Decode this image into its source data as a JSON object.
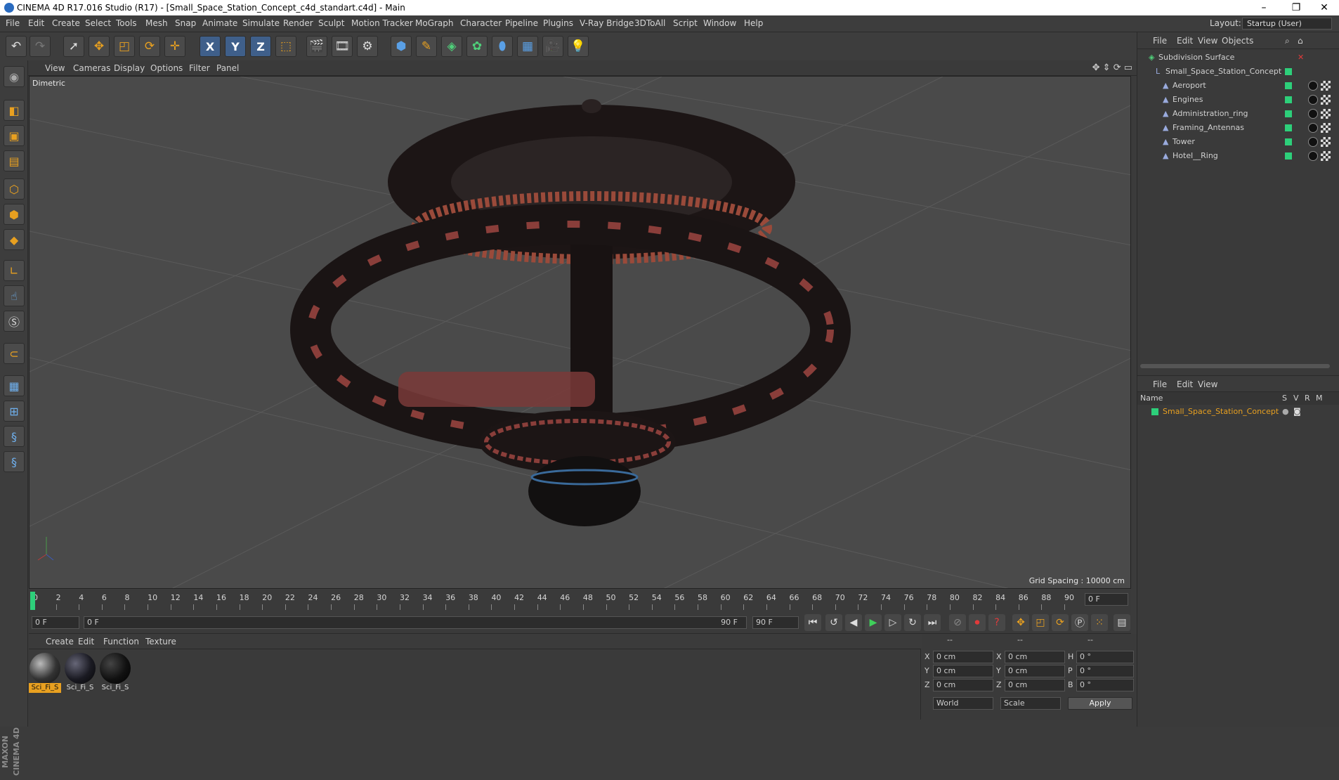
{
  "titlebar": {
    "title": "CINEMA 4D R17.016 Studio (R17) - [Small_Space_Station_Concept_c4d_standart.c4d] - Main",
    "minimize": "–",
    "maximize": "❐",
    "close": "✕"
  },
  "menu": [
    "File",
    "Edit",
    "Create",
    "Select",
    "Tools",
    "Mesh",
    "Snap",
    "Animate",
    "Simulate",
    "Render",
    "Sculpt",
    "Motion Tracker",
    "MoGraph",
    "Character",
    "Pipeline",
    "Plugins",
    "V-Ray Bridge",
    "3DToAll",
    "Script",
    "Window",
    "Help"
  ],
  "layout": {
    "label": "Layout:",
    "value": "Startup (User)"
  },
  "toolbar": {
    "axis_x": "X",
    "axis_y": "Y",
    "axis_z": "Z"
  },
  "viewport": {
    "menu": [
      "View",
      "Cameras",
      "Display",
      "Options",
      "Filter",
      "Panel"
    ],
    "name": "Dimetric",
    "grid_spacing": "Grid Spacing : 10000 cm"
  },
  "timeline": {
    "ticks": [
      "0",
      "2",
      "4",
      "6",
      "8",
      "10",
      "12",
      "14",
      "16",
      "18",
      "20",
      "22",
      "24",
      "26",
      "28",
      "30",
      "32",
      "34",
      "36",
      "38",
      "40",
      "42",
      "44",
      "46",
      "48",
      "50",
      "52",
      "54",
      "56",
      "58",
      "60",
      "62",
      "64",
      "66",
      "68",
      "70",
      "72",
      "74",
      "76",
      "78",
      "80",
      "82",
      "84",
      "86",
      "88",
      "90"
    ],
    "current_frame": "0 F",
    "start_field": "0 F",
    "range_start": "0 F",
    "range_end": "90 F",
    "end_field": "90 F"
  },
  "materials": {
    "menu": [
      "Create",
      "Edit",
      "Function",
      "Texture"
    ],
    "items": [
      {
        "label": "Sci_Fi_S"
      },
      {
        "label": "Sci_Fi_S"
      },
      {
        "label": "Sci_Fi_S"
      }
    ]
  },
  "coords": {
    "header": [
      "--",
      "--",
      "--"
    ],
    "rows": [
      {
        "a": "X",
        "av": "0 cm",
        "b": "X",
        "bv": "0 cm",
        "c": "H",
        "cv": "0 °"
      },
      {
        "a": "Y",
        "av": "0 cm",
        "b": "Y",
        "bv": "0 cm",
        "c": "P",
        "cv": "0 °"
      },
      {
        "a": "Z",
        "av": "0 cm",
        "b": "Z",
        "bv": "0 cm",
        "c": "B",
        "cv": "0 °"
      }
    ],
    "mode1": "World",
    "mode2": "Scale",
    "apply": "Apply"
  },
  "objects": {
    "menu": [
      "File",
      "Edit",
      "View",
      "Objects"
    ],
    "tree": [
      {
        "name": "Subdivision Surface",
        "indent": 0
      },
      {
        "name": "Small_Space_Station_Concept",
        "indent": 1
      },
      {
        "name": "Aeroport",
        "indent": 2
      },
      {
        "name": "Engines",
        "indent": 2
      },
      {
        "name": "Administration_ring",
        "indent": 2
      },
      {
        "name": "Framing_Antennas",
        "indent": 2
      },
      {
        "name": "Tower",
        "indent": 2
      },
      {
        "name": "Hotel__Ring",
        "indent": 2
      }
    ]
  },
  "layers": {
    "menu": [
      "File",
      "Edit",
      "View"
    ],
    "columns": {
      "name": "Name",
      "s": "S",
      "v": "V",
      "r": "R",
      "m": "M"
    },
    "row": "Small_Space_Station_Concept"
  }
}
